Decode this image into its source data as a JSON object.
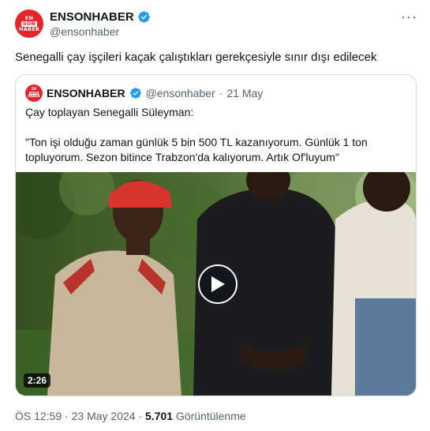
{
  "author": {
    "name": "ENSONHABER",
    "handle": "@ensonhaber",
    "avatar_lines": [
      "EN",
      "SON",
      "HABER"
    ]
  },
  "tweet_text": "Senegalli çay işçileri kaçak çalıştıkları gerekçesiyle sınır dışı edilecek",
  "quote": {
    "name": "ENSONHABER",
    "handle": "@ensonhaber",
    "separator": "·",
    "date": "21 May",
    "line1": "Çay toplayan Senegalli Süleyman:",
    "line2": "\"Ton işi olduğu zaman günlük 5 bin 500 TL kazanıyorum. Günlük 1 ton topluyorum. Sezon bitince Trabzon'da kalıyorum. Artık Of'luyum\""
  },
  "video": {
    "duration": "2:26"
  },
  "footer": {
    "time": "ÖS 12:59",
    "separator1": "·",
    "date": "23 May 2024",
    "separator2": "·",
    "views_count": "5.701",
    "views_label": "Görüntülenme"
  },
  "colors": {
    "brand_red": "#e2262c",
    "verified_blue": "#1d9bf0",
    "muted": "#536471"
  },
  "icons": [
    "verified-badge-icon",
    "more-icon",
    "play-icon"
  ]
}
